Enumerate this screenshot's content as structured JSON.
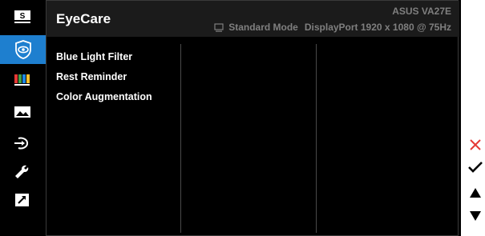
{
  "header": {
    "title": "EyeCare",
    "model": "ASUS  VA27E",
    "mode": "Standard Mode",
    "input": "DisplayPort 1920 x 1080 @ 75Hz"
  },
  "sidebar": {
    "items": [
      {
        "icon": "splendid-icon",
        "selected": false
      },
      {
        "icon": "eye-icon",
        "selected": true
      },
      {
        "icon": "color-bars-icon",
        "selected": false
      },
      {
        "icon": "image-icon",
        "selected": false
      },
      {
        "icon": "input-select-icon",
        "selected": false
      },
      {
        "icon": "wrench-icon",
        "selected": false
      },
      {
        "icon": "shortcut-icon",
        "selected": false
      }
    ]
  },
  "menu": {
    "items": [
      "Blue Light Filter",
      "Rest Reminder",
      "Color Augmentation"
    ]
  },
  "nav": {
    "buttons": [
      "close-icon",
      "check-icon",
      "up-arrow-icon",
      "down-arrow-icon"
    ]
  },
  "colors": {
    "accent": "#1e7fcf",
    "close": "#e53935",
    "text_dim": "#7f7f7f"
  }
}
